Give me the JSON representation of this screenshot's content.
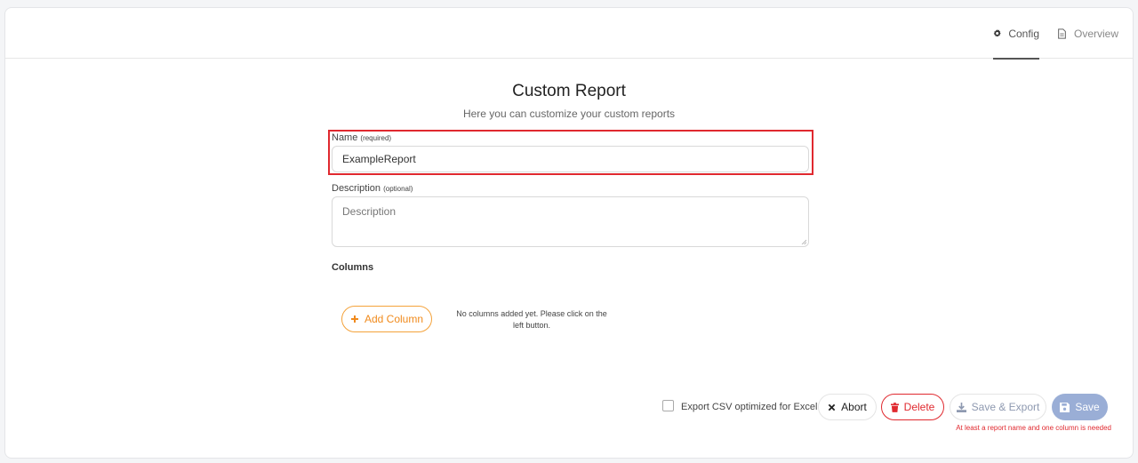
{
  "tabs": {
    "config_label": "Config",
    "overview_label": "Overview",
    "active": "Config"
  },
  "page": {
    "title": "Custom Report",
    "subtitle": "Here you can customize your custom reports"
  },
  "form": {
    "name_label": "Name",
    "name_hint": "(required)",
    "name_value": "ExampleReport",
    "description_label": "Description",
    "description_hint": "(optional)",
    "description_placeholder": "Description",
    "columns_title": "Columns",
    "add_column_label": "Add Column",
    "empty_columns_text": "No columns added yet. Please click on the left button."
  },
  "footer": {
    "export_csv_label": "Export CSV optimized for Excel",
    "export_csv_checked": false,
    "abort_label": "Abort",
    "delete_label": "Delete",
    "save_export_label": "Save & Export",
    "save_label": "Save",
    "error_text": "At least a report name and one column is needed"
  },
  "colors": {
    "accent_orange": "#f08a1c",
    "danger_red": "#e0292f",
    "save_disabled": "#9aaed6"
  },
  "icons": {
    "config": "gear-icon",
    "overview": "document-icon",
    "add": "plus-icon",
    "abort": "x-icon",
    "delete": "trash-icon",
    "save_export": "download-icon",
    "save": "floppy-disk-icon"
  }
}
